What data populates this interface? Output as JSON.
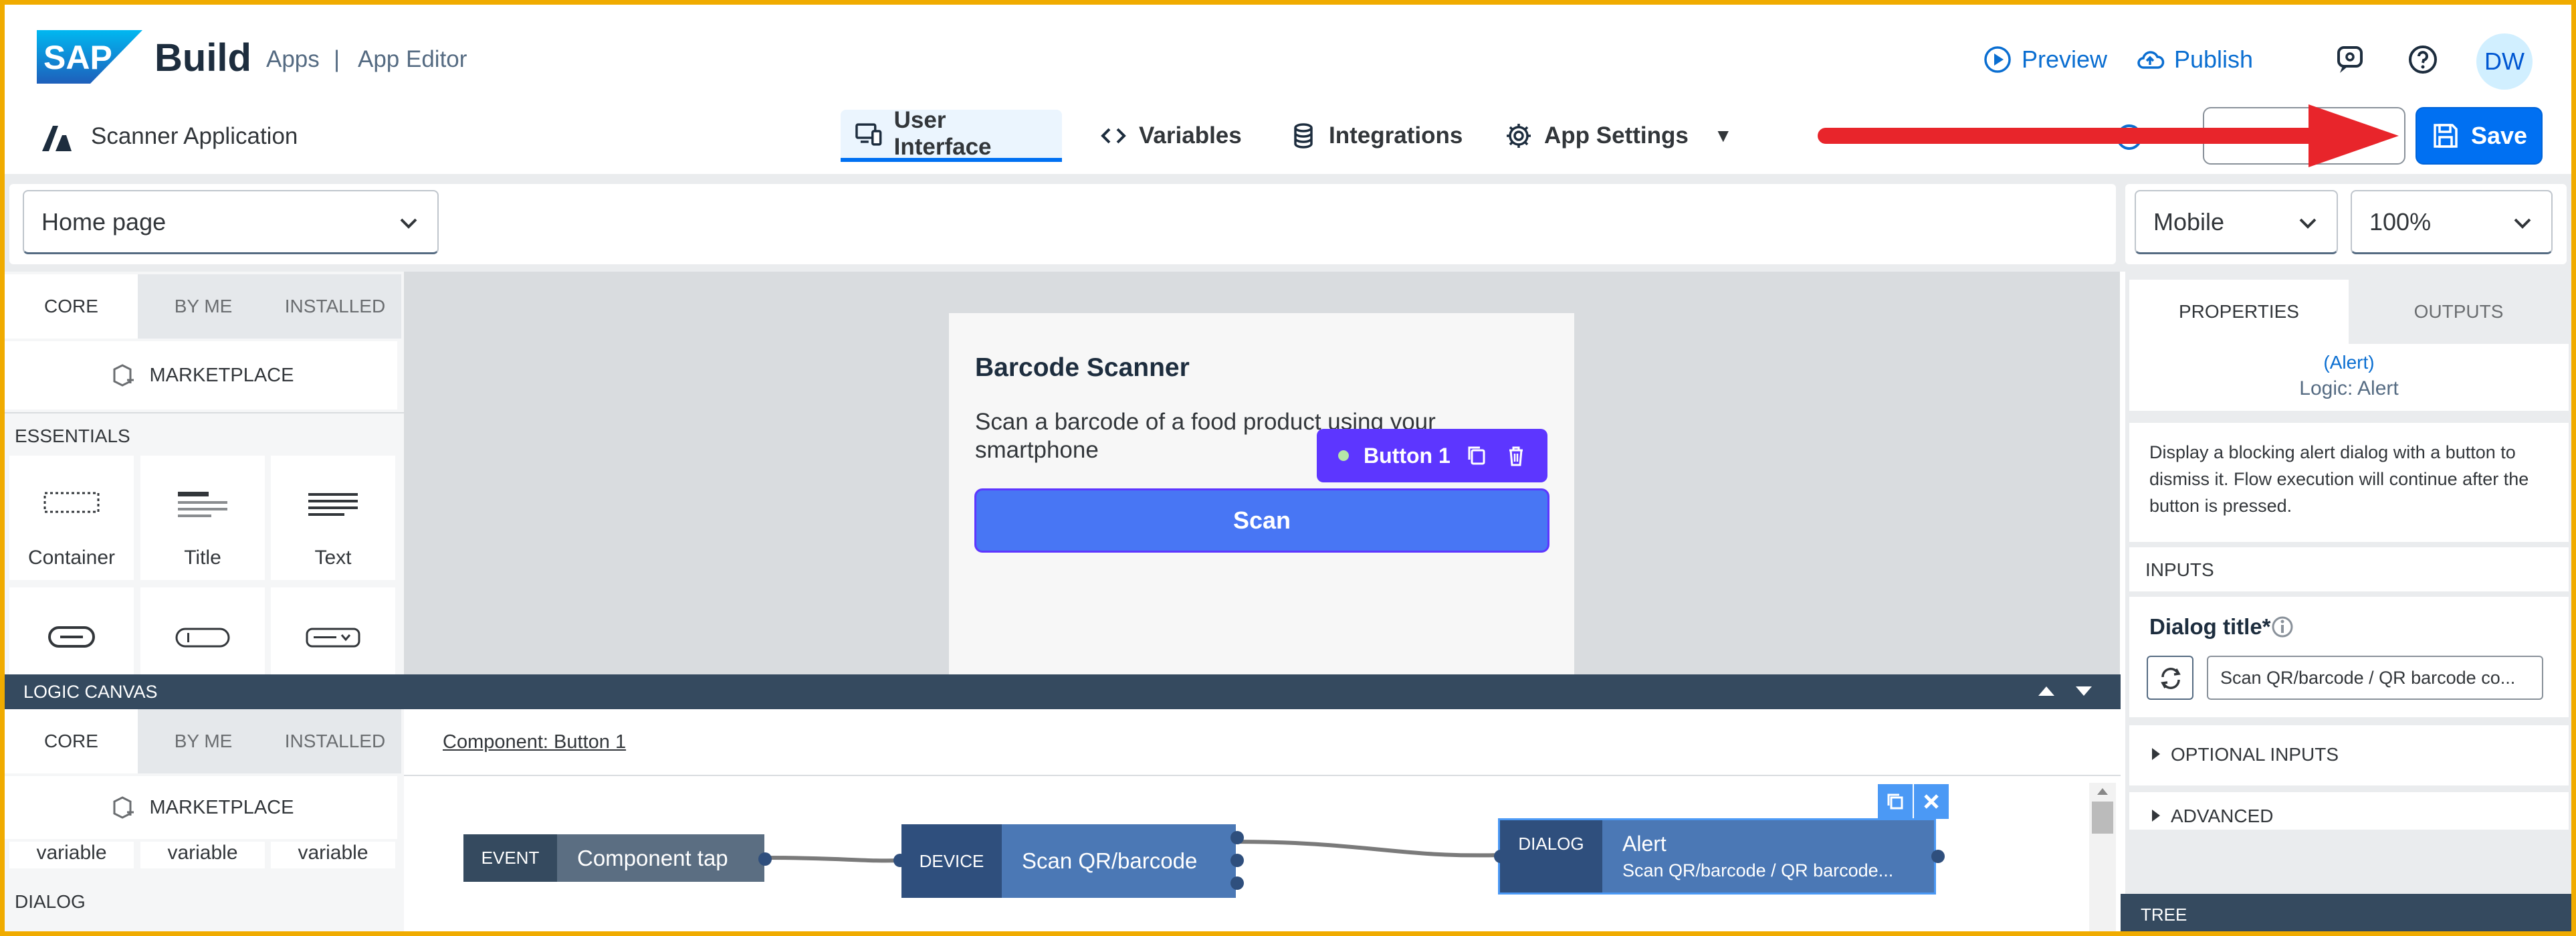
{
  "shell": {
    "brand": "SAP",
    "product": "Build",
    "crumb_apps": "Apps",
    "crumb_sep": "|",
    "crumb_editor": "App Editor",
    "preview_label": "Preview",
    "publish_label": "Publish",
    "avatar_initials": "DW"
  },
  "app_bar": {
    "app_name": "Scanner Application",
    "tabs": [
      {
        "label": "User Interface"
      },
      {
        "label": "Variables"
      },
      {
        "label": "Integrations"
      },
      {
        "label": "App Settings"
      }
    ],
    "save_label": "Save"
  },
  "page_bar": {
    "page_select": "Home page",
    "device_select": "Mobile",
    "zoom_select": "100%"
  },
  "component_library": {
    "tabs": [
      "CORE",
      "BY ME",
      "INSTALLED"
    ],
    "marketplace_label": "MARKETPLACE",
    "section": "ESSENTIALS",
    "tiles": [
      "Container",
      "Title",
      "Text"
    ]
  },
  "canvas": {
    "page_title": "Barcode Scanner",
    "page_text": "Scan a barcode of a food product using your smartphone",
    "selected_component": "Button 1",
    "scan_button": "Scan"
  },
  "logic": {
    "bar_title": "LOGIC CANVAS",
    "tabs": [
      "CORE",
      "BY ME",
      "INSTALLED"
    ],
    "marketplace_label": "MARKETPLACE",
    "var_tiles": [
      "variable",
      "variable",
      "variable"
    ],
    "section": "DIALOG",
    "component_link": "Component: Button 1",
    "nodes": {
      "event_kind": "EVENT",
      "event_label": "Component tap",
      "device_kind": "DEVICE",
      "device_label": "Scan QR/barcode",
      "dialog_kind": "DIALOG",
      "dialog_label": "Alert",
      "dialog_sub": "Scan QR/barcode / QR barcode..."
    }
  },
  "properties": {
    "tabs": [
      "PROPERTIES",
      "OUTPUTS"
    ],
    "link": "(Alert)",
    "logic_name": "Logic: Alert",
    "description": "Display a blocking alert dialog with a button to dismiss it. Flow execution will continue after the button is pressed.",
    "inputs_header": "INPUTS",
    "dialog_title_label": "Dialog title*",
    "dialog_title_value": "Scan QR/barcode / QR barcode co...",
    "optional_inputs": "OPTIONAL INPUTS",
    "advanced": "ADVANCED",
    "tree": "TREE"
  },
  "colors": {
    "accent": "#0070f2",
    "selection": "#5d36ff",
    "scan_button": "#4876f4",
    "annotation_arrow": "#e8252b",
    "frame": "#f0ab00"
  }
}
